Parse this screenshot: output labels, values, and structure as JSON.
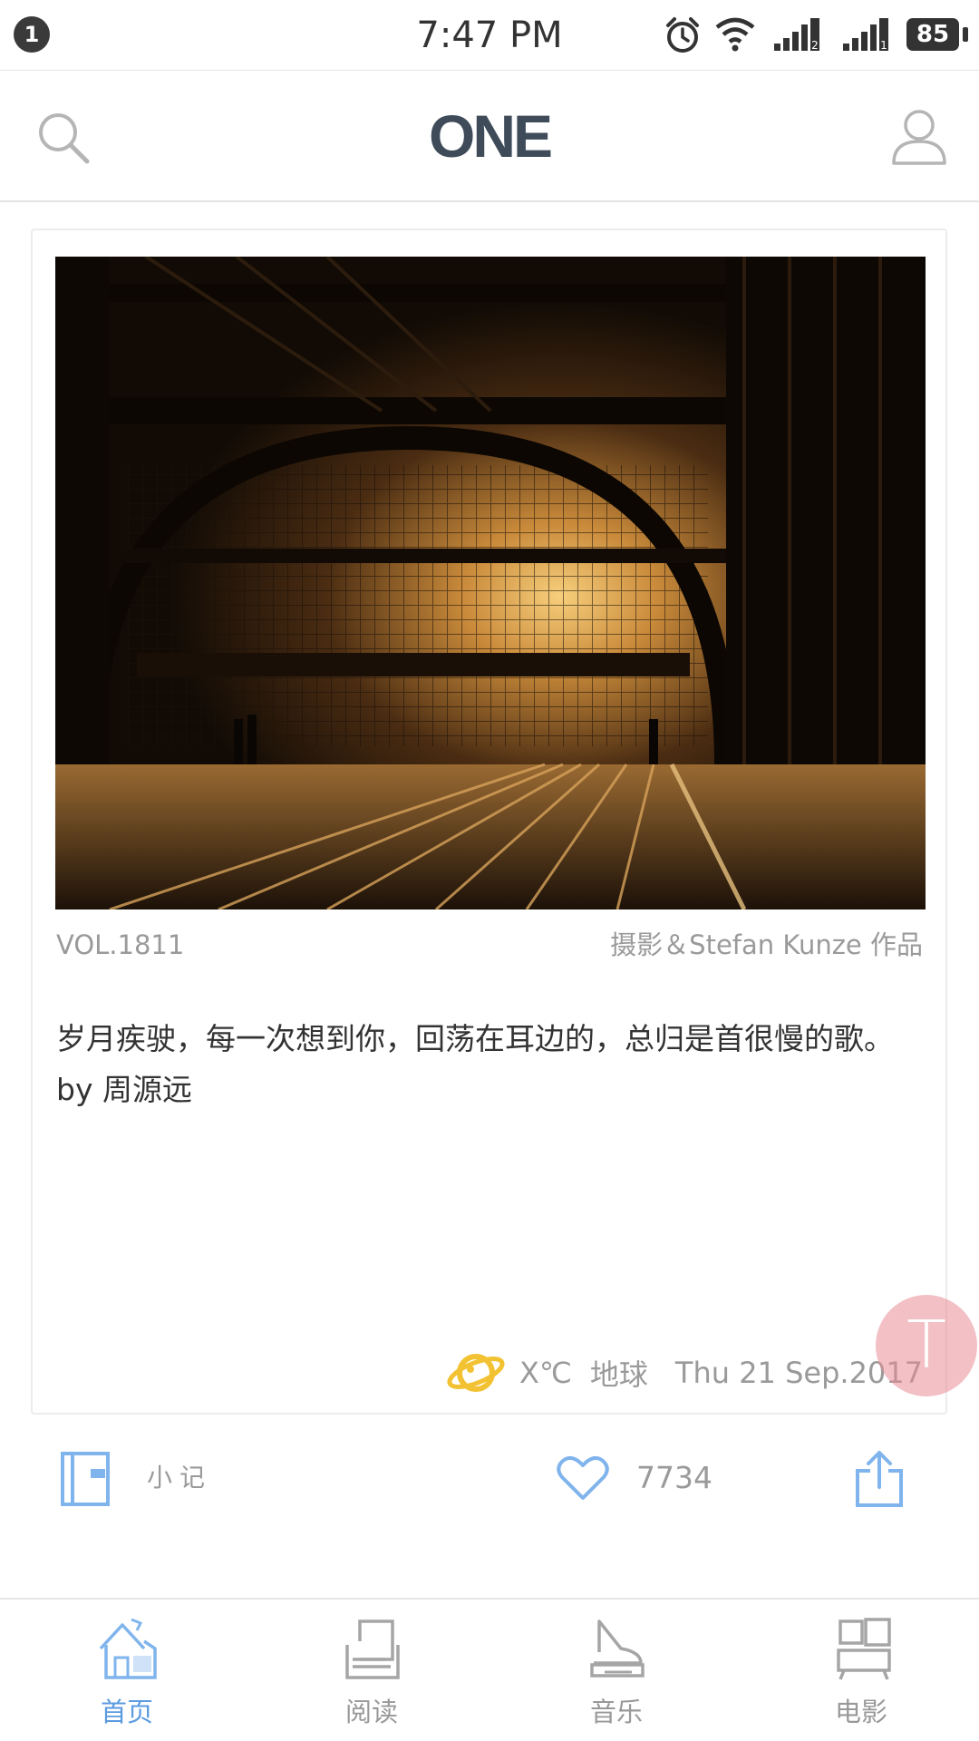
{
  "status_bar": {
    "notification_count": "1",
    "time": "7:47 PM",
    "battery": "85",
    "icons": [
      "alarm-icon",
      "wifi-icon",
      "signal-icon",
      "signal-icon"
    ]
  },
  "header": {
    "logo": "ONE",
    "left_icon": "search-icon",
    "right_icon": "user-icon"
  },
  "card": {
    "photo_subject": "railway-station",
    "volume": "VOL.1811",
    "credit": "摄影＆Stefan Kunze 作品",
    "quote": "岁月疾驶，每一次想到你，回荡在耳边的，总归是首很慢的歌。 by 周源远",
    "weather": "X℃",
    "place": "地球",
    "date": "Thu  21 Sep.2017",
    "meta_icon": "planet-icon"
  },
  "fab": {
    "letter": "T"
  },
  "actions": {
    "note_label": "小记",
    "like_count": "7734",
    "icons": [
      "notebook-icon",
      "heart-icon",
      "share-icon"
    ]
  },
  "tabs": [
    {
      "label": "首页",
      "icon": "home-icon",
      "active": true
    },
    {
      "label": "阅读",
      "icon": "reading-icon",
      "active": false
    },
    {
      "label": "音乐",
      "icon": "music-icon",
      "active": false
    },
    {
      "label": "电影",
      "icon": "movie-icon",
      "active": false
    }
  ],
  "colors": {
    "accent": "#5b9be0",
    "logo": "#3f4b59",
    "secondary_text": "#9a9a9a",
    "planet": "#f3c232",
    "fab": "#e88c96"
  }
}
